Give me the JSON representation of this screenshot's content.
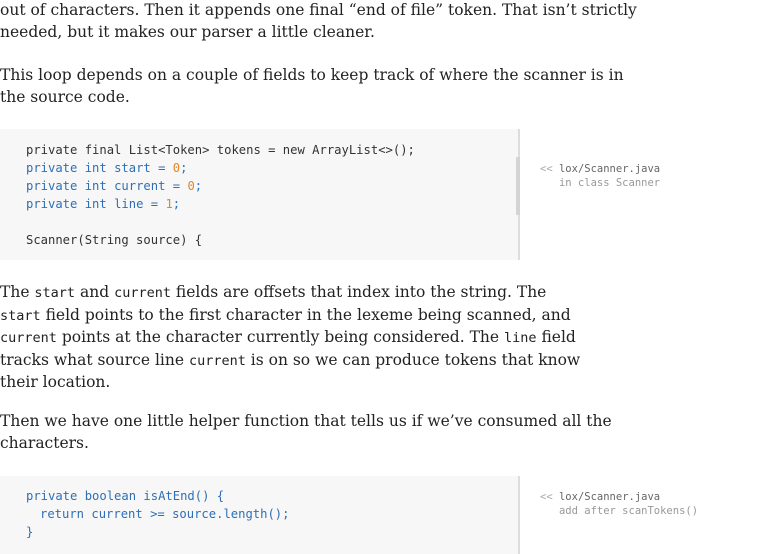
{
  "para_intro": {
    "line1": "out of characters. Then it appends one final “end of file” token. That isn’t strictly",
    "line2": "needed, but it makes our parser a little cleaner."
  },
  "para_loop": {
    "line1": "This loop depends on a couple of fields to keep track of where the scanner is in",
    "line2": "the source code."
  },
  "code1": {
    "line1": "private final List<Token> tokens = new ArrayList<>();",
    "line2_kw": "private int ",
    "line2_id": "start",
    "line2_eq": " = ",
    "line2_num": "0",
    "line2_end": ";",
    "line3_kw": "private int ",
    "line3_id": "current",
    "line3_eq": " = ",
    "line3_num": "0",
    "line3_end": ";",
    "line4_kw": "private int ",
    "line4_id": "line",
    "line4_eq": " = ",
    "line4_num": "1",
    "line4_end": ";",
    "line5": "Scanner(String source) {"
  },
  "aside1": {
    "marker": "<<",
    "file": "lox/Scanner.java",
    "sub": "in class Scanner"
  },
  "para_fields": {
    "l1_a": "The ",
    "l1_c1": "start",
    "l1_b": " and ",
    "l1_c2": "current",
    "l1_d": " fields are offsets that index into the string. The",
    "l2_c1": "start",
    "l2_a": " field points to the first character in the lexeme being scanned, and",
    "l3_c1": "current",
    "l3_a": " points at the character currently being considered. The ",
    "l3_c2": "line",
    "l3_b": " field",
    "l4_a": "tracks what source line ",
    "l4_c1": "current",
    "l4_b": " is on so we can produce tokens that know",
    "l5": "their location."
  },
  "para_helper": {
    "line1": "Then we have one little helper function that tells us if we’ve consumed all the",
    "line2": "characters."
  },
  "code2": {
    "line1": "private boolean isAtEnd() {",
    "line2_kw": "return ",
    "line2_rest": "current >= source.length();",
    "line3": "}"
  },
  "aside2": {
    "marker": "<<",
    "file": "lox/Scanner.java",
    "sub": "add after scanTokens()"
  }
}
